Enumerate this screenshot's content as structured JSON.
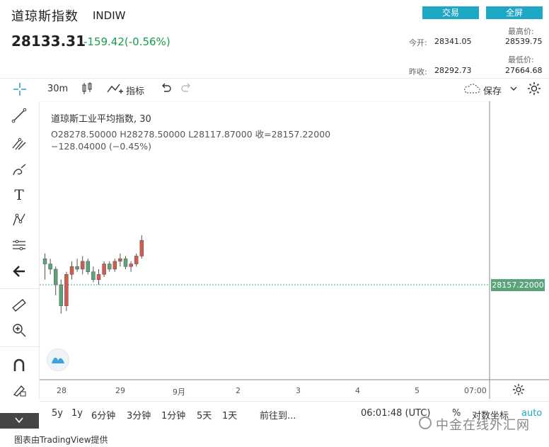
{
  "header": {
    "title": "道琼斯指数",
    "code": "INDIW",
    "price": "28133.31",
    "change": "-159.42(-0.56%)",
    "trade_button": "交易",
    "fullscreen_button": "全屏",
    "open_label": "今开:",
    "open_value": "28341.05",
    "high_label": "最高价:",
    "high_value": "28539.75",
    "prev_close_label": "昨收:",
    "prev_close_value": "28292.73",
    "low_label": "最低价:",
    "low_value": "27664.68"
  },
  "toolbar": {
    "interval": "30m",
    "indicators_label": "指标",
    "save_label": "保存"
  },
  "legend": {
    "symbol": "道琼斯工业平均指数, 30",
    "ohlc": "O28278.50000   H28278.50000   L28117.87000   收=28157.22000",
    "change": "−128.04000 (−0.45%)"
  },
  "price_tag": "28157.22000",
  "x_axis": {
    "labels": [
      "28",
      "29",
      "9月",
      "2",
      "3",
      "4",
      "5",
      "07:00"
    ]
  },
  "bottom_bar": {
    "ranges": [
      "5y",
      "1y",
      "6分钟",
      "3分钟",
      "1分钟",
      "5天",
      "1天"
    ],
    "goto": "前往到...",
    "clock": "06:01:48 (UTC)",
    "percent": "%",
    "log": "对数坐标",
    "auto": "auto"
  },
  "footer": "图表由TradingView提供",
  "watermark": "中金在线外汇网",
  "colors": {
    "up": "#d25a4f",
    "down": "#5ba47a",
    "accent": "#1fa7c6"
  },
  "chart_data": {
    "type": "candlestick",
    "last_price": 28157.22,
    "x_ticks": [
      "28",
      "29",
      "9月",
      "2",
      "3",
      "4",
      "5",
      "07:00"
    ],
    "candles": [
      [
        28040,
        28060,
        27960,
        28020
      ],
      [
        28020,
        28040,
        27980,
        28000
      ],
      [
        28000,
        28010,
        27900,
        27940
      ],
      [
        27940,
        27960,
        27830,
        27860
      ],
      [
        27860,
        27990,
        27840,
        27980
      ],
      [
        27980,
        28030,
        27960,
        28010
      ],
      [
        28010,
        28040,
        27990,
        28000
      ],
      [
        28000,
        28050,
        27980,
        28030
      ],
      [
        28030,
        28040,
        27980,
        27990
      ],
      [
        27990,
        28010,
        27950,
        27960
      ],
      [
        27960,
        28000,
        27940,
        27980
      ],
      [
        27980,
        28030,
        27970,
        28020
      ],
      [
        28020,
        28030,
        27990,
        28000
      ],
      [
        28000,
        28040,
        27990,
        28030
      ],
      [
        28030,
        28060,
        28010,
        28040
      ],
      [
        28040,
        28050,
        28000,
        28010
      ],
      [
        28010,
        28030,
        27990,
        28020
      ],
      [
        28020,
        28060,
        28010,
        28050
      ],
      [
        28050,
        28130,
        28040,
        28110
      ]
    ]
  }
}
